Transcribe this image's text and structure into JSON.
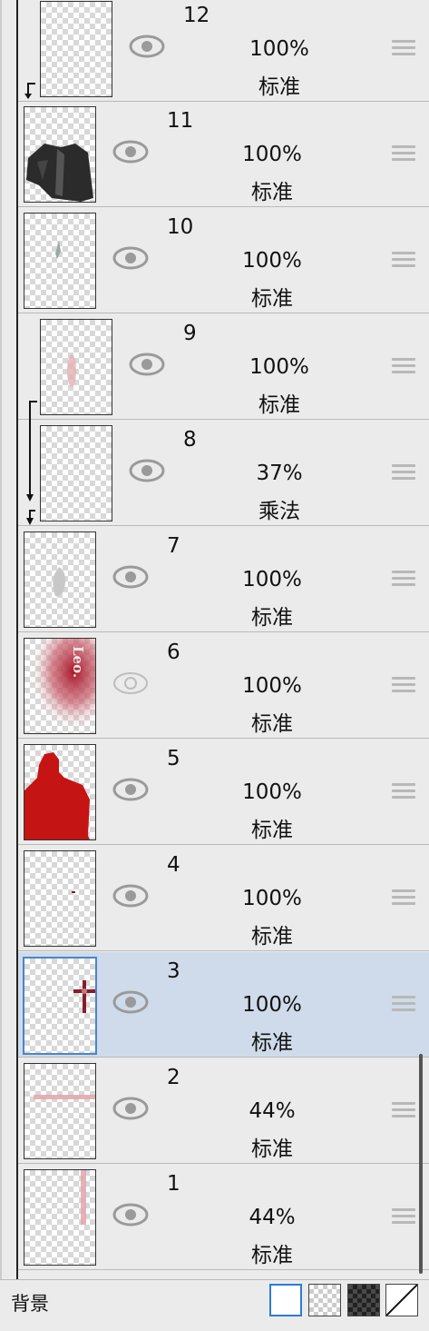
{
  "layers": [
    {
      "number": "12",
      "opacity": "100%",
      "blend": "标准",
      "visible": true,
      "clipped": true
    },
    {
      "number": "11",
      "opacity": "100%",
      "blend": "标准",
      "visible": true,
      "clipped": false
    },
    {
      "number": "10",
      "opacity": "100%",
      "blend": "标准",
      "visible": true,
      "clipped": false
    },
    {
      "number": "9",
      "opacity": "100%",
      "blend": "标准",
      "visible": true,
      "clipped": true
    },
    {
      "number": "8",
      "opacity": "37%",
      "blend": "乘法",
      "visible": true,
      "clipped": true
    },
    {
      "number": "7",
      "opacity": "100%",
      "blend": "标准",
      "visible": true,
      "clipped": false
    },
    {
      "number": "6",
      "opacity": "100%",
      "blend": "标准",
      "visible": false,
      "clipped": false,
      "thumb_text": "Leo."
    },
    {
      "number": "5",
      "opacity": "100%",
      "blend": "标准",
      "visible": true,
      "clipped": false
    },
    {
      "number": "4",
      "opacity": "100%",
      "blend": "标准",
      "visible": true,
      "clipped": false
    },
    {
      "number": "3",
      "opacity": "100%",
      "blend": "标准",
      "visible": true,
      "clipped": false,
      "selected": true
    },
    {
      "number": "2",
      "opacity": "44%",
      "blend": "标准",
      "visible": true,
      "clipped": false
    },
    {
      "number": "1",
      "opacity": "44%",
      "blend": "标准",
      "visible": true,
      "clipped": false
    }
  ],
  "footer": {
    "label": "背景",
    "options": [
      "white-background",
      "transparent-background",
      "dark-checker-background",
      "no-background"
    ],
    "selected": "white-background"
  },
  "colors": {
    "panel": "#ecebec",
    "selected_row": "#cfdbea",
    "selected_border": "#4a86c8",
    "eye_visible": "#9a9a9a",
    "eye_hidden": "#bdbdbd",
    "red": "#c41414"
  }
}
